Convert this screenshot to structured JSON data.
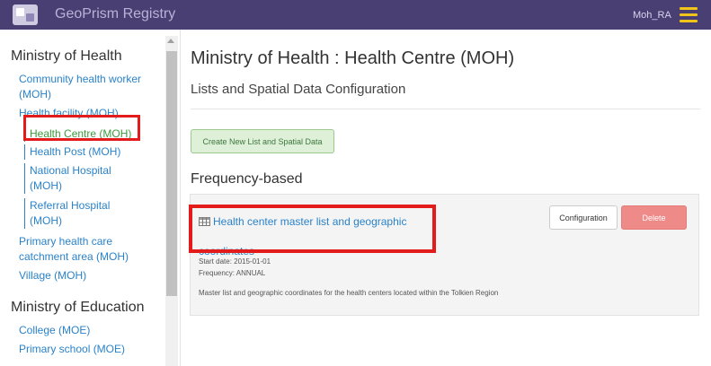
{
  "header": {
    "app_title": "GeoPrism Registry",
    "user": "Moh_RA",
    "colors": {
      "bar": "#4a3f73",
      "menu": "#f0c419"
    },
    "icons": {
      "logo": "logo-icon",
      "menu": "hamburger-menu-icon"
    }
  },
  "sidebar": {
    "groups": [
      {
        "title": "Ministry of Health",
        "items": [
          {
            "label": "Community health worker (MOH)"
          },
          {
            "label": "Health facility (MOH)"
          },
          {
            "label": "Health Centre (MOH)",
            "selected": true
          },
          {
            "label": "Health Post (MOH)"
          },
          {
            "label": "National Hospital (MOH)"
          },
          {
            "label": "Referral Hospital (MOH)"
          },
          {
            "label": "Primary health care catchment area (MOH)"
          },
          {
            "label": "Village (MOH)"
          }
        ]
      },
      {
        "title": "Ministry of Education",
        "items": [
          {
            "label": "College (MOE)"
          },
          {
            "label": "Primary school (MOE)"
          }
        ]
      }
    ],
    "highlight_color": "#e31b1b"
  },
  "main": {
    "title": "Ministry of Health : Health Centre (MOH)",
    "subtitle": "Lists and Spatial Data Configuration",
    "create_button": "Create New List and Spatial Data",
    "section": "Frequency-based",
    "lists": [
      {
        "title": "Health center master list and geographic coordinates",
        "icon": "table-icon",
        "start_date": "Start date: 2015-01-01",
        "frequency": "Frequency: ANNUAL",
        "description": "Master list and geographic coordinates for the health centers located within the Tolkien Region",
        "configuration_label": "Configuration",
        "delete_label": "Delete"
      }
    ]
  }
}
